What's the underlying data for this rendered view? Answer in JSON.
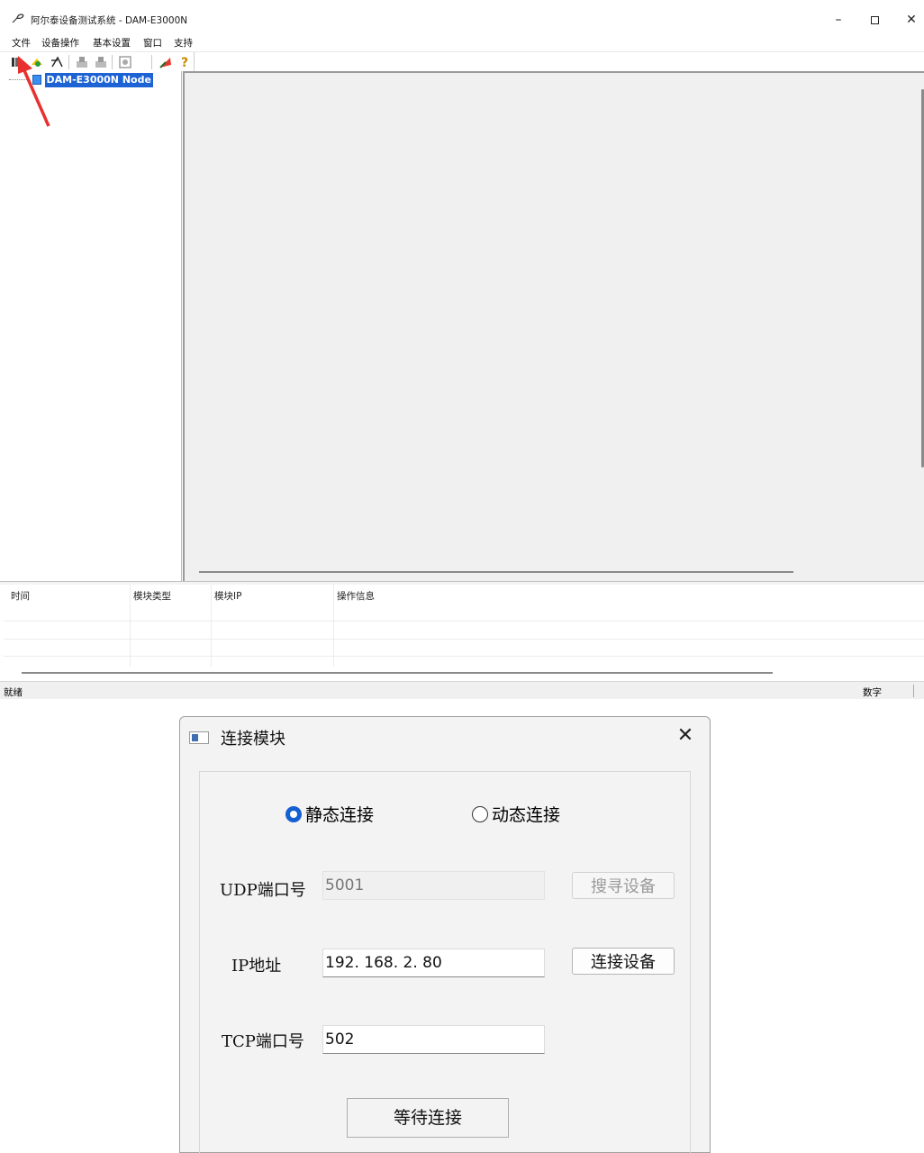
{
  "window": {
    "title": "阿尔泰设备测试系统 - DAM-E3000N",
    "minimize_glyph": "–",
    "close_glyph": "✕"
  },
  "menu": [
    "文件",
    "设备操作",
    "基本设置",
    "窗口",
    "支持"
  ],
  "toolbar": {
    "icons": [
      "connect-module-icon",
      "search-device-icon",
      "disconnect-icon",
      "download-icon",
      "upload-icon",
      "monitor-icon",
      "paint-icon",
      "help-icon"
    ]
  },
  "tree": {
    "node_label": "DAM-E3000N Node"
  },
  "log_table": {
    "columns": [
      "时间",
      "模块类型",
      "模块IP",
      "操作信息"
    ]
  },
  "statusbar": {
    "ready": "就绪",
    "numlock": "数字"
  },
  "dialog": {
    "title": "连接模块",
    "close_glyph": "✕",
    "radio_static": "静态连接",
    "radio_dynamic": "动态连接",
    "selected_mode": "静态连接",
    "udp_label": "UDP端口号",
    "udp_value": "5001",
    "search_button": "搜寻设备",
    "ip_label": "IP地址",
    "ip_value": "192. 168. 2. 80",
    "connect_button": "连接设备",
    "tcp_label": "TCP端口号",
    "tcp_value": "502",
    "status": "等待连接"
  },
  "colors": {
    "selection": "#1e63d4",
    "radio_selected": "#1460d2",
    "annotation_arrow": "#e8312f"
  }
}
